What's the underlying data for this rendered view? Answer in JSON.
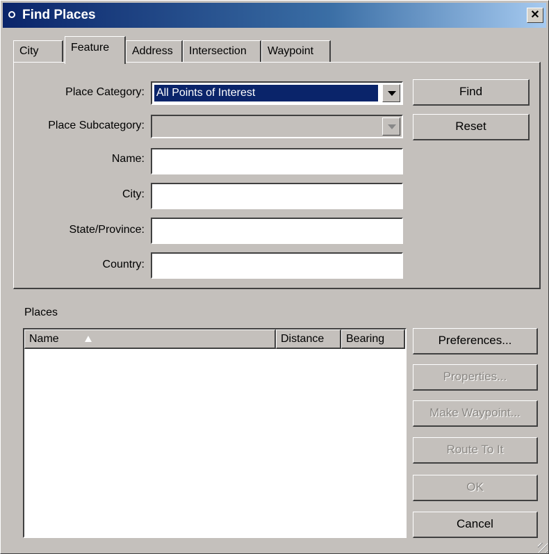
{
  "window": {
    "title": "Find Places",
    "close_glyph": "✕"
  },
  "tabs": [
    {
      "label": "City"
    },
    {
      "label": "Feature"
    },
    {
      "label": "Address"
    },
    {
      "label": "Intersection"
    },
    {
      "label": "Waypoint"
    }
  ],
  "active_tab": "Feature",
  "form": {
    "place_category_label": "Place Category:",
    "place_category_value": "All Points of Interest",
    "place_subcategory_label": "Place Subcategory:",
    "place_subcategory_value": "",
    "name_label": "Name:",
    "name_value": "",
    "city_label": "City:",
    "city_value": "",
    "state_label": "State/Province:",
    "state_value": "",
    "country_label": "Country:",
    "country_value": ""
  },
  "buttons": {
    "find": "Find",
    "reset": "Reset",
    "preferences": "Preferences...",
    "properties": "Properties...",
    "make_waypoint": "Make Waypoint...",
    "route_to_it": "Route To It",
    "ok": "OK",
    "cancel": "Cancel"
  },
  "places": {
    "section_label": "Places",
    "columns": [
      "Name",
      "Distance",
      "Bearing"
    ],
    "rows": []
  },
  "icons": [
    "window-icon",
    "close-icon",
    "dropdown-arrow-icon",
    "sort-ascending-icon",
    "resize-grip-icon"
  ]
}
